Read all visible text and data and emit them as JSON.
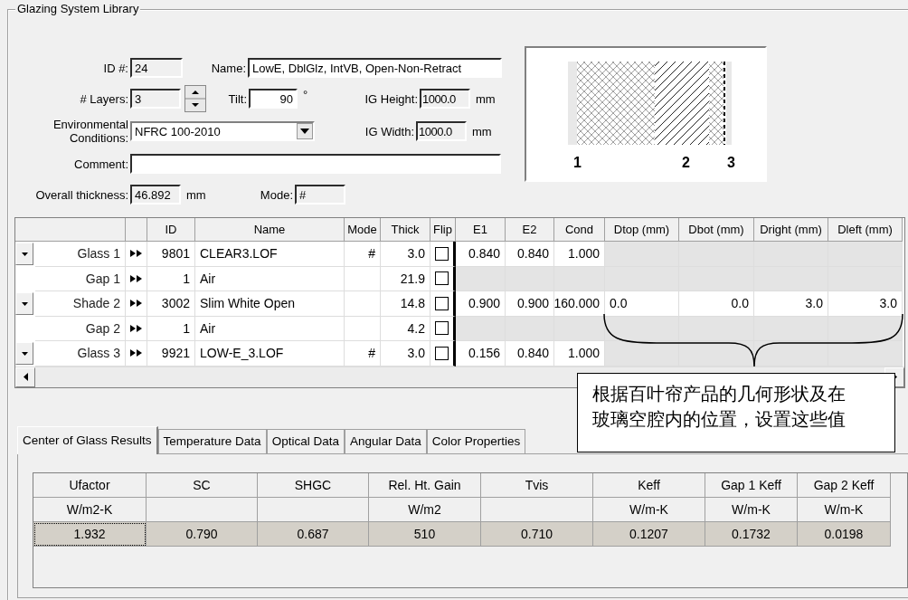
{
  "group_title": "Glazing System Library",
  "form": {
    "id": {
      "label": "ID #:",
      "value": "24"
    },
    "name": {
      "label": "Name:",
      "value": "LowE, DblGlz, IntVB, Open-Non-Retract"
    },
    "layers": {
      "label": "# Layers:",
      "value": "3"
    },
    "tilt": {
      "label": "Tilt:",
      "value": "90",
      "unit": "°"
    },
    "ig_height": {
      "label": "IG Height:",
      "value": "1000.0",
      "unit": "mm"
    },
    "environment": {
      "label": "Environmental Conditions:",
      "value": "NFRC 100-2010"
    },
    "ig_width": {
      "label": "IG Width:",
      "value": "1000.0",
      "unit": "mm"
    },
    "comment": {
      "label": "Comment:"
    },
    "thickness": {
      "label": "Overall thickness:",
      "value": "46.892",
      "unit": "mm"
    },
    "mode": {
      "label": "Mode:",
      "value": "#"
    }
  },
  "diagram": {
    "layer_labels": [
      "1",
      "2",
      "3"
    ]
  },
  "layers_table": {
    "columns": [
      "ID",
      "Name",
      "Mode",
      "Thick",
      "Flip",
      "E1",
      "E2",
      "Cond",
      "Dtop (mm)",
      "Dbot (mm)",
      "Dright (mm)",
      "Dleft (mm)"
    ],
    "rows": [
      {
        "kind": "glass",
        "label": "Glass 1",
        "id": "9801",
        "name": "CLEAR3.LOF",
        "mode": "#",
        "thick": "3.0",
        "flip": false,
        "e1": "0.840",
        "e2": "0.840",
        "cond": "1.000"
      },
      {
        "kind": "gap",
        "label": "Gap 1",
        "id": "1",
        "name": "Air",
        "thick": "21.9",
        "flip": false
      },
      {
        "kind": "shade",
        "label": "Shade 2",
        "id": "3002",
        "name": "Slim White Open",
        "thick": "14.8",
        "flip": false,
        "e1": "0.900",
        "e2": "0.900",
        "cond": "160.000",
        "dtop": "0.0",
        "dbot": "0.0",
        "dright": "3.0",
        "dleft": "3.0"
      },
      {
        "kind": "gap",
        "label": "Gap 2",
        "id": "1",
        "name": "Air",
        "thick": "4.2",
        "flip": false
      },
      {
        "kind": "glass",
        "label": "Glass 3",
        "id": "9921",
        "name": "LOW-E_3.LOF",
        "mode": "#",
        "thick": "3.0",
        "flip": false,
        "e1": "0.156",
        "e2": "0.840",
        "cond": "1.000"
      }
    ]
  },
  "callout": "根据百叶帘产品的几何形状及在玻璃空腔内的位置，设置这些值",
  "tabs": [
    {
      "label": "Center of Glass Results",
      "selected": true
    },
    {
      "label": "Temperature Data",
      "selected": false
    },
    {
      "label": "Optical Data",
      "selected": false
    },
    {
      "label": "Angular Data",
      "selected": false
    },
    {
      "label": "Color Properties",
      "selected": false
    }
  ],
  "results": [
    {
      "name": "Ufactor",
      "unit": "W/m2-K",
      "value": "1.932",
      "focused": true
    },
    {
      "name": "SC",
      "value": "0.790",
      "focused": false
    },
    {
      "name": "SHGC",
      "value": "0.687",
      "focused": false
    },
    {
      "name": "Rel. Ht. Gain",
      "unit": "W/m2",
      "value": "510",
      "focused": false
    },
    {
      "name": "Tvis",
      "value": "0.710",
      "focused": false
    },
    {
      "name": "Keff",
      "unit": "W/m-K",
      "value": "0.1207",
      "focused": false
    },
    {
      "name": "Gap 1 Keff",
      "unit": "W/m-K",
      "value": "0.1732",
      "focused": false
    },
    {
      "name": "Gap 2 Keff",
      "unit": "W/m-K",
      "value": "0.0198",
      "focused": false
    }
  ]
}
